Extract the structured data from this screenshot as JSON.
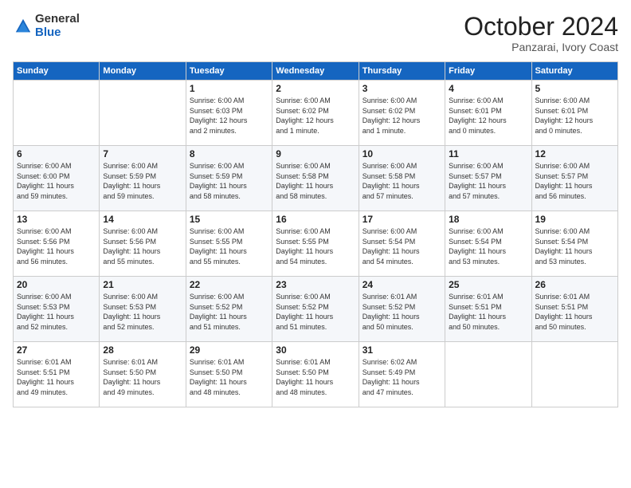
{
  "logo": {
    "general": "General",
    "blue": "Blue"
  },
  "header": {
    "month": "October 2024",
    "location": "Panzarai, Ivory Coast"
  },
  "weekdays": [
    "Sunday",
    "Monday",
    "Tuesday",
    "Wednesday",
    "Thursday",
    "Friday",
    "Saturday"
  ],
  "weeks": [
    [
      {
        "day": "",
        "content": ""
      },
      {
        "day": "",
        "content": ""
      },
      {
        "day": "1",
        "content": "Sunrise: 6:00 AM\nSunset: 6:03 PM\nDaylight: 12 hours\nand 2 minutes."
      },
      {
        "day": "2",
        "content": "Sunrise: 6:00 AM\nSunset: 6:02 PM\nDaylight: 12 hours\nand 1 minute."
      },
      {
        "day": "3",
        "content": "Sunrise: 6:00 AM\nSunset: 6:02 PM\nDaylight: 12 hours\nand 1 minute."
      },
      {
        "day": "4",
        "content": "Sunrise: 6:00 AM\nSunset: 6:01 PM\nDaylight: 12 hours\nand 0 minutes."
      },
      {
        "day": "5",
        "content": "Sunrise: 6:00 AM\nSunset: 6:01 PM\nDaylight: 12 hours\nand 0 minutes."
      }
    ],
    [
      {
        "day": "6",
        "content": "Sunrise: 6:00 AM\nSunset: 6:00 PM\nDaylight: 11 hours\nand 59 minutes."
      },
      {
        "day": "7",
        "content": "Sunrise: 6:00 AM\nSunset: 5:59 PM\nDaylight: 11 hours\nand 59 minutes."
      },
      {
        "day": "8",
        "content": "Sunrise: 6:00 AM\nSunset: 5:59 PM\nDaylight: 11 hours\nand 58 minutes."
      },
      {
        "day": "9",
        "content": "Sunrise: 6:00 AM\nSunset: 5:58 PM\nDaylight: 11 hours\nand 58 minutes."
      },
      {
        "day": "10",
        "content": "Sunrise: 6:00 AM\nSunset: 5:58 PM\nDaylight: 11 hours\nand 57 minutes."
      },
      {
        "day": "11",
        "content": "Sunrise: 6:00 AM\nSunset: 5:57 PM\nDaylight: 11 hours\nand 57 minutes."
      },
      {
        "day": "12",
        "content": "Sunrise: 6:00 AM\nSunset: 5:57 PM\nDaylight: 11 hours\nand 56 minutes."
      }
    ],
    [
      {
        "day": "13",
        "content": "Sunrise: 6:00 AM\nSunset: 5:56 PM\nDaylight: 11 hours\nand 56 minutes."
      },
      {
        "day": "14",
        "content": "Sunrise: 6:00 AM\nSunset: 5:56 PM\nDaylight: 11 hours\nand 55 minutes."
      },
      {
        "day": "15",
        "content": "Sunrise: 6:00 AM\nSunset: 5:55 PM\nDaylight: 11 hours\nand 55 minutes."
      },
      {
        "day": "16",
        "content": "Sunrise: 6:00 AM\nSunset: 5:55 PM\nDaylight: 11 hours\nand 54 minutes."
      },
      {
        "day": "17",
        "content": "Sunrise: 6:00 AM\nSunset: 5:54 PM\nDaylight: 11 hours\nand 54 minutes."
      },
      {
        "day": "18",
        "content": "Sunrise: 6:00 AM\nSunset: 5:54 PM\nDaylight: 11 hours\nand 53 minutes."
      },
      {
        "day": "19",
        "content": "Sunrise: 6:00 AM\nSunset: 5:54 PM\nDaylight: 11 hours\nand 53 minutes."
      }
    ],
    [
      {
        "day": "20",
        "content": "Sunrise: 6:00 AM\nSunset: 5:53 PM\nDaylight: 11 hours\nand 52 minutes."
      },
      {
        "day": "21",
        "content": "Sunrise: 6:00 AM\nSunset: 5:53 PM\nDaylight: 11 hours\nand 52 minutes."
      },
      {
        "day": "22",
        "content": "Sunrise: 6:00 AM\nSunset: 5:52 PM\nDaylight: 11 hours\nand 51 minutes."
      },
      {
        "day": "23",
        "content": "Sunrise: 6:00 AM\nSunset: 5:52 PM\nDaylight: 11 hours\nand 51 minutes."
      },
      {
        "day": "24",
        "content": "Sunrise: 6:01 AM\nSunset: 5:52 PM\nDaylight: 11 hours\nand 50 minutes."
      },
      {
        "day": "25",
        "content": "Sunrise: 6:01 AM\nSunset: 5:51 PM\nDaylight: 11 hours\nand 50 minutes."
      },
      {
        "day": "26",
        "content": "Sunrise: 6:01 AM\nSunset: 5:51 PM\nDaylight: 11 hours\nand 50 minutes."
      }
    ],
    [
      {
        "day": "27",
        "content": "Sunrise: 6:01 AM\nSunset: 5:51 PM\nDaylight: 11 hours\nand 49 minutes."
      },
      {
        "day": "28",
        "content": "Sunrise: 6:01 AM\nSunset: 5:50 PM\nDaylight: 11 hours\nand 49 minutes."
      },
      {
        "day": "29",
        "content": "Sunrise: 6:01 AM\nSunset: 5:50 PM\nDaylight: 11 hours\nand 48 minutes."
      },
      {
        "day": "30",
        "content": "Sunrise: 6:01 AM\nSunset: 5:50 PM\nDaylight: 11 hours\nand 48 minutes."
      },
      {
        "day": "31",
        "content": "Sunrise: 6:02 AM\nSunset: 5:49 PM\nDaylight: 11 hours\nand 47 minutes."
      },
      {
        "day": "",
        "content": ""
      },
      {
        "day": "",
        "content": ""
      }
    ]
  ]
}
